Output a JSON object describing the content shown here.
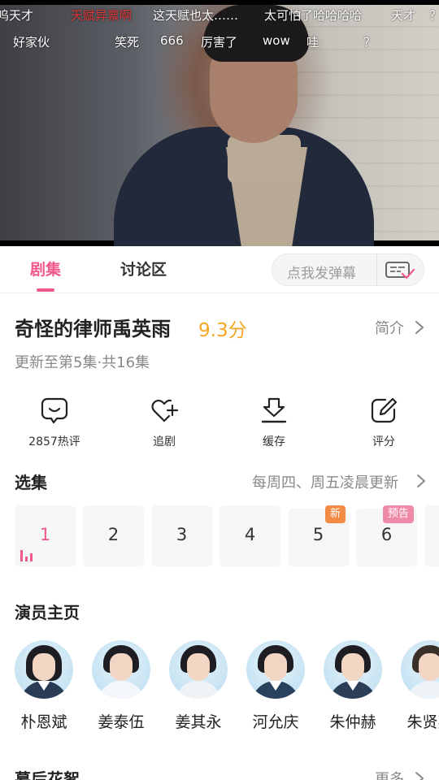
{
  "player": {
    "danmaku": [
      {
        "text": "呜天才",
        "style": "white"
      },
      {
        "text": "天赋异禀啊",
        "style": "red"
      },
      {
        "text": "这天赋也太……",
        "style": "white"
      },
      {
        "text": "太可怕了哈哈哈哈",
        "style": "white"
      },
      {
        "text": "天才",
        "style": "white"
      },
      {
        "text": "？",
        "style": "white"
      },
      {
        "text": "好家伙",
        "style": "white"
      },
      {
        "text": "笑死",
        "style": "white"
      },
      {
        "text": "666",
        "style": "white"
      },
      {
        "text": "厉害了",
        "style": "white"
      },
      {
        "text": "wow",
        "style": "white"
      },
      {
        "text": "哇",
        "style": "white"
      },
      {
        "text": "？",
        "style": "white"
      }
    ]
  },
  "tabs": [
    {
      "label": "剧集",
      "active": true
    },
    {
      "label": "讨论区",
      "active": false
    }
  ],
  "danmu_input": {
    "placeholder": "点我发弹幕",
    "icon": "danmaku-settings-icon"
  },
  "show": {
    "title": "奇怪的律师禹英雨",
    "score": "9.3分",
    "intro_label": "简介",
    "update_info": "更新至第5集·共16集"
  },
  "actions": [
    {
      "label": "2857热评",
      "icon": "comment-icon"
    },
    {
      "label": "追剧",
      "icon": "heart-plus-icon"
    },
    {
      "label": "缓存",
      "icon": "download-icon"
    },
    {
      "label": "评分",
      "icon": "edit-icon"
    }
  ],
  "episodes": {
    "title": "选集",
    "schedule": "每周四、周五凌晨更新",
    "items": [
      {
        "num": "1",
        "current": true,
        "badge": ""
      },
      {
        "num": "2",
        "current": false,
        "badge": ""
      },
      {
        "num": "3",
        "current": false,
        "badge": ""
      },
      {
        "num": "4",
        "current": false,
        "badge": ""
      },
      {
        "num": "5",
        "current": false,
        "badge": "新"
      },
      {
        "num": "6",
        "current": false,
        "badge": "预告"
      }
    ]
  },
  "cast": {
    "title": "演员主页",
    "actors": [
      {
        "name": "朴恩斌"
      },
      {
        "name": "姜泰伍"
      },
      {
        "name": "姜其永"
      },
      {
        "name": "河允庆"
      },
      {
        "name": "朱仲赫"
      },
      {
        "name": "朱贤英"
      }
    ]
  },
  "bottom_section": {
    "title": "幕后花絮",
    "more_label": "更多"
  },
  "colors": {
    "accent": "#f0578d",
    "score": "#f5a623",
    "badge_new": "#f48b45",
    "badge_preview": "#f08aa9"
  }
}
